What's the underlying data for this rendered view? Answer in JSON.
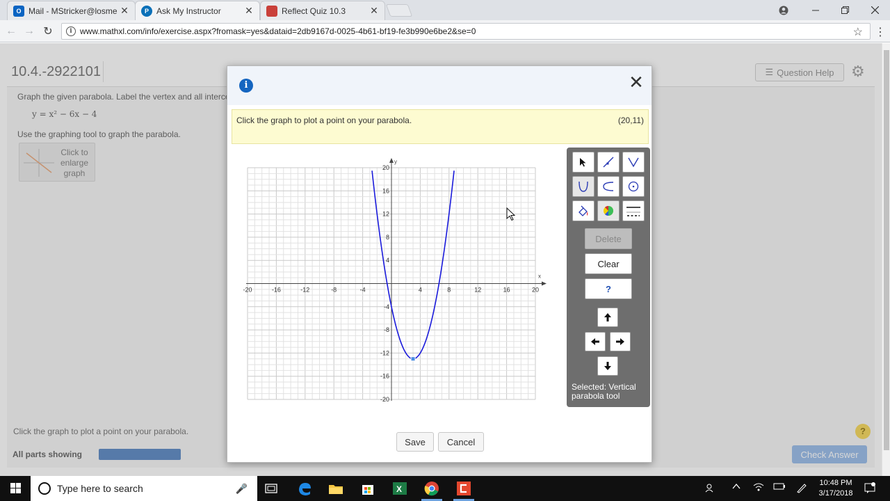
{
  "browser": {
    "tabs": [
      {
        "label": "Mail - MStricker@losmed",
        "icon": "outlook-icon"
      },
      {
        "label": "Ask My Instructor",
        "icon": "pearson-icon"
      },
      {
        "label": "Reflect Quiz 10.3",
        "icon": "canvas-icon"
      }
    ],
    "url": "www.mathxl.com/info/exercise.aspx?fromask=yes&dataid=2db9167d-0025-4b61-bf19-fe3b990e6be2&se=0"
  },
  "page": {
    "question_id": "10.4.-2922101",
    "question_help": "Question Help",
    "instruction": "Graph the given parabola. Label the vertex and all intercepts",
    "equation": "y = x² − 6x − 4",
    "tool_instruction": "Use the graphing tool to graph the parabola.",
    "enlarge_label": "Click to enlarge graph",
    "bottom_hint": "Click the graph to plot a point on your parabola.",
    "all_parts": "All parts showing",
    "check_answer": "Check Answer",
    "help_glyph": "?"
  },
  "modal": {
    "hint": "Click the graph to plot a point on your parabola.",
    "coordinate": "(20,11)",
    "save": "Save",
    "cancel": "Cancel",
    "tools": {
      "delete": "Delete",
      "clear": "Clear",
      "help": "?",
      "selected_note": "Selected: Vertical parabola tool"
    }
  },
  "chart_data": {
    "type": "line",
    "xlabel": "x",
    "ylabel": "y",
    "xlim": [
      -20,
      20
    ],
    "ylim": [
      -20,
      20
    ],
    "grid": true,
    "x_ticks": [
      -20,
      -16,
      -12,
      -8,
      -4,
      4,
      8,
      12,
      16,
      20
    ],
    "y_ticks": [
      -20,
      -16,
      -12,
      -8,
      -4,
      4,
      8,
      12,
      16,
      20
    ],
    "series": [
      {
        "equation": "y = x^2 - 6x - 4",
        "vertex": [
          3,
          -13
        ],
        "color": "#1a1adb"
      }
    ]
  },
  "taskbar": {
    "search_placeholder": "Type here to search",
    "time": "10:48 PM",
    "date": "3/17/2018"
  },
  "colors": {
    "accent": "#1565c0",
    "hint_bg": "#fdfbd1",
    "toolbox_bg": "#6e6e6e",
    "curve": "#1a1adb"
  }
}
